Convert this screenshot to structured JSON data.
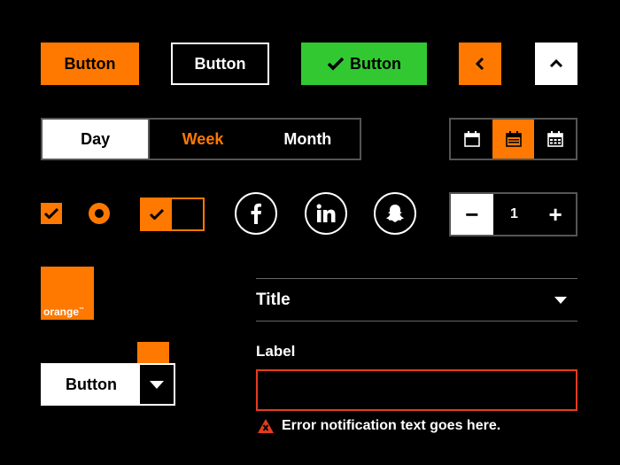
{
  "buttons": {
    "primary_label": "Button",
    "secondary_label": "Button",
    "success_label": "Button",
    "back_icon": "chevron-left-icon",
    "up_icon": "chevron-up-icon"
  },
  "segmented": {
    "items": [
      "Day",
      "Week",
      "Month"
    ],
    "active": "Day"
  },
  "calendar_toggle": {
    "items": [
      "calendar-day-icon",
      "calendar-week-icon",
      "calendar-month-icon"
    ],
    "active_index": 1
  },
  "controls": {
    "checkbox_checked": true,
    "radio_selected": true,
    "toggle_on": true
  },
  "social": [
    "facebook-icon",
    "linkedin-icon",
    "snapchat-icon"
  ],
  "stepper": {
    "minus": "−",
    "value": "1",
    "plus": "+"
  },
  "logos": {
    "brand_text": "orange",
    "tm": "™"
  },
  "accordion": {
    "title": "Title"
  },
  "split_button": {
    "label": "Button"
  },
  "form": {
    "label": "Label",
    "value": "",
    "error_text": "Error notification text goes here."
  },
  "colors": {
    "accent": "#ff7900",
    "success": "#32c832",
    "error": "#e63c1e",
    "background": "#000000"
  }
}
